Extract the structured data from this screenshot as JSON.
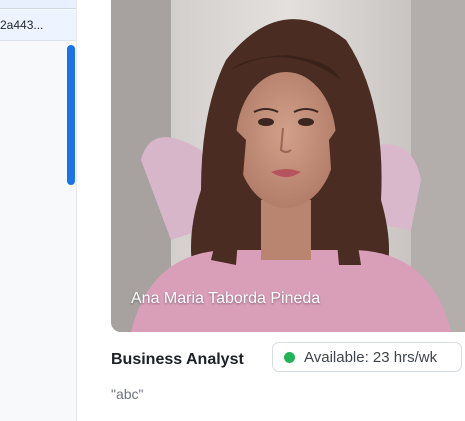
{
  "sidebar": {
    "selected_item_text": "2a443..."
  },
  "profile": {
    "name": "Ana Maria Taborda Pineda",
    "role": "Business Analyst",
    "availability": "Available: 23 hrs/wk",
    "availability_color": "#22b455",
    "note": "\"abc\""
  }
}
